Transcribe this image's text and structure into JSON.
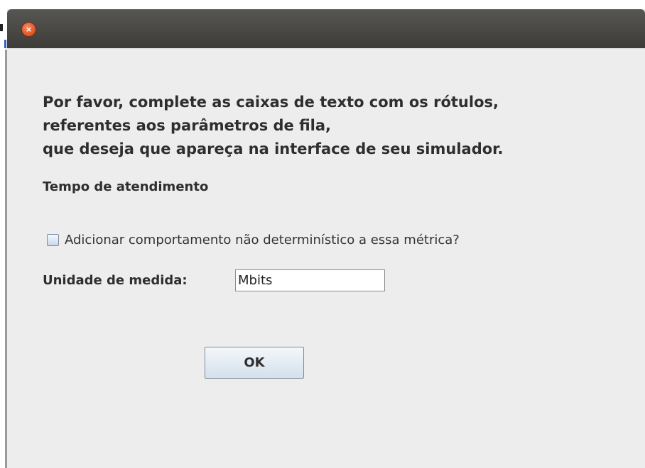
{
  "window": {
    "close_glyph": "×"
  },
  "dialog": {
    "message_lines": [
      "Por favor, complete as caixas de texto com os rótulos,",
      "referentes aos parâmetros de fila,",
      "que deseja que apareça na interface de seu simulador."
    ],
    "subtitle": "Tempo de atendimento",
    "checkbox_label": "Adicionar comportamento não determinístico a essa métrica?",
    "checkbox_checked": false,
    "unit_label": "Unidade de medida:",
    "unit_value": "Mbits",
    "ok_label": "OK"
  },
  "colors": {
    "titlebar": "#3d3c38",
    "close_button": "#e15a2b",
    "dialog_background": "#ededed"
  }
}
